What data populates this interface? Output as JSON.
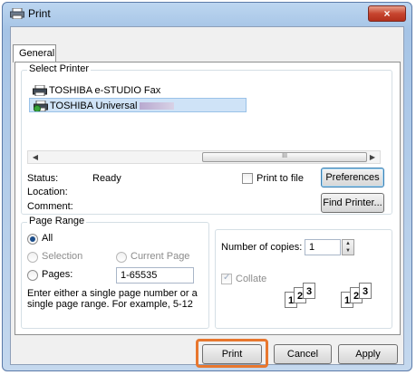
{
  "window": {
    "title": "Print",
    "close_symbol": "×"
  },
  "tabs": [
    {
      "label": "General"
    }
  ],
  "select_printer": {
    "label": "Select Printer",
    "printers": [
      {
        "name": "TOSHIBA e-STUDIO Fax",
        "selected": false
      },
      {
        "name": "TOSHIBA Universal",
        "selected": true
      }
    ],
    "scroll_mid_glyph": "III",
    "status_label": "Status:",
    "status_value": "Ready",
    "location_label": "Location:",
    "comment_label": "Comment:",
    "print_to_file_label": "Print to file",
    "preferences_label": "Preferences",
    "find_printer_label": "Find Printer..."
  },
  "page_range": {
    "label": "Page Range",
    "all_label": "All",
    "selection_label": "Selection",
    "current_page_label": "Current Page",
    "pages_label": "Pages:",
    "pages_value": "1-65535",
    "hint": "Enter either a single page number or a single page range.  For example, 5-12"
  },
  "copies": {
    "number_label": "Number of copies:",
    "value": "1",
    "collate_label": "Collate"
  },
  "buttons": {
    "print": "Print",
    "cancel": "Cancel",
    "apply": "Apply"
  },
  "colors": {
    "highlight": "#e8772e",
    "title_close": "#c7452f",
    "selection_bg": "#cfe3f7"
  },
  "icons": [
    "printer-icon",
    "close-icon",
    "checkbox-icon",
    "radio-icon",
    "spinner-up-icon",
    "spinner-down-icon",
    "collate-pages-icon"
  ]
}
